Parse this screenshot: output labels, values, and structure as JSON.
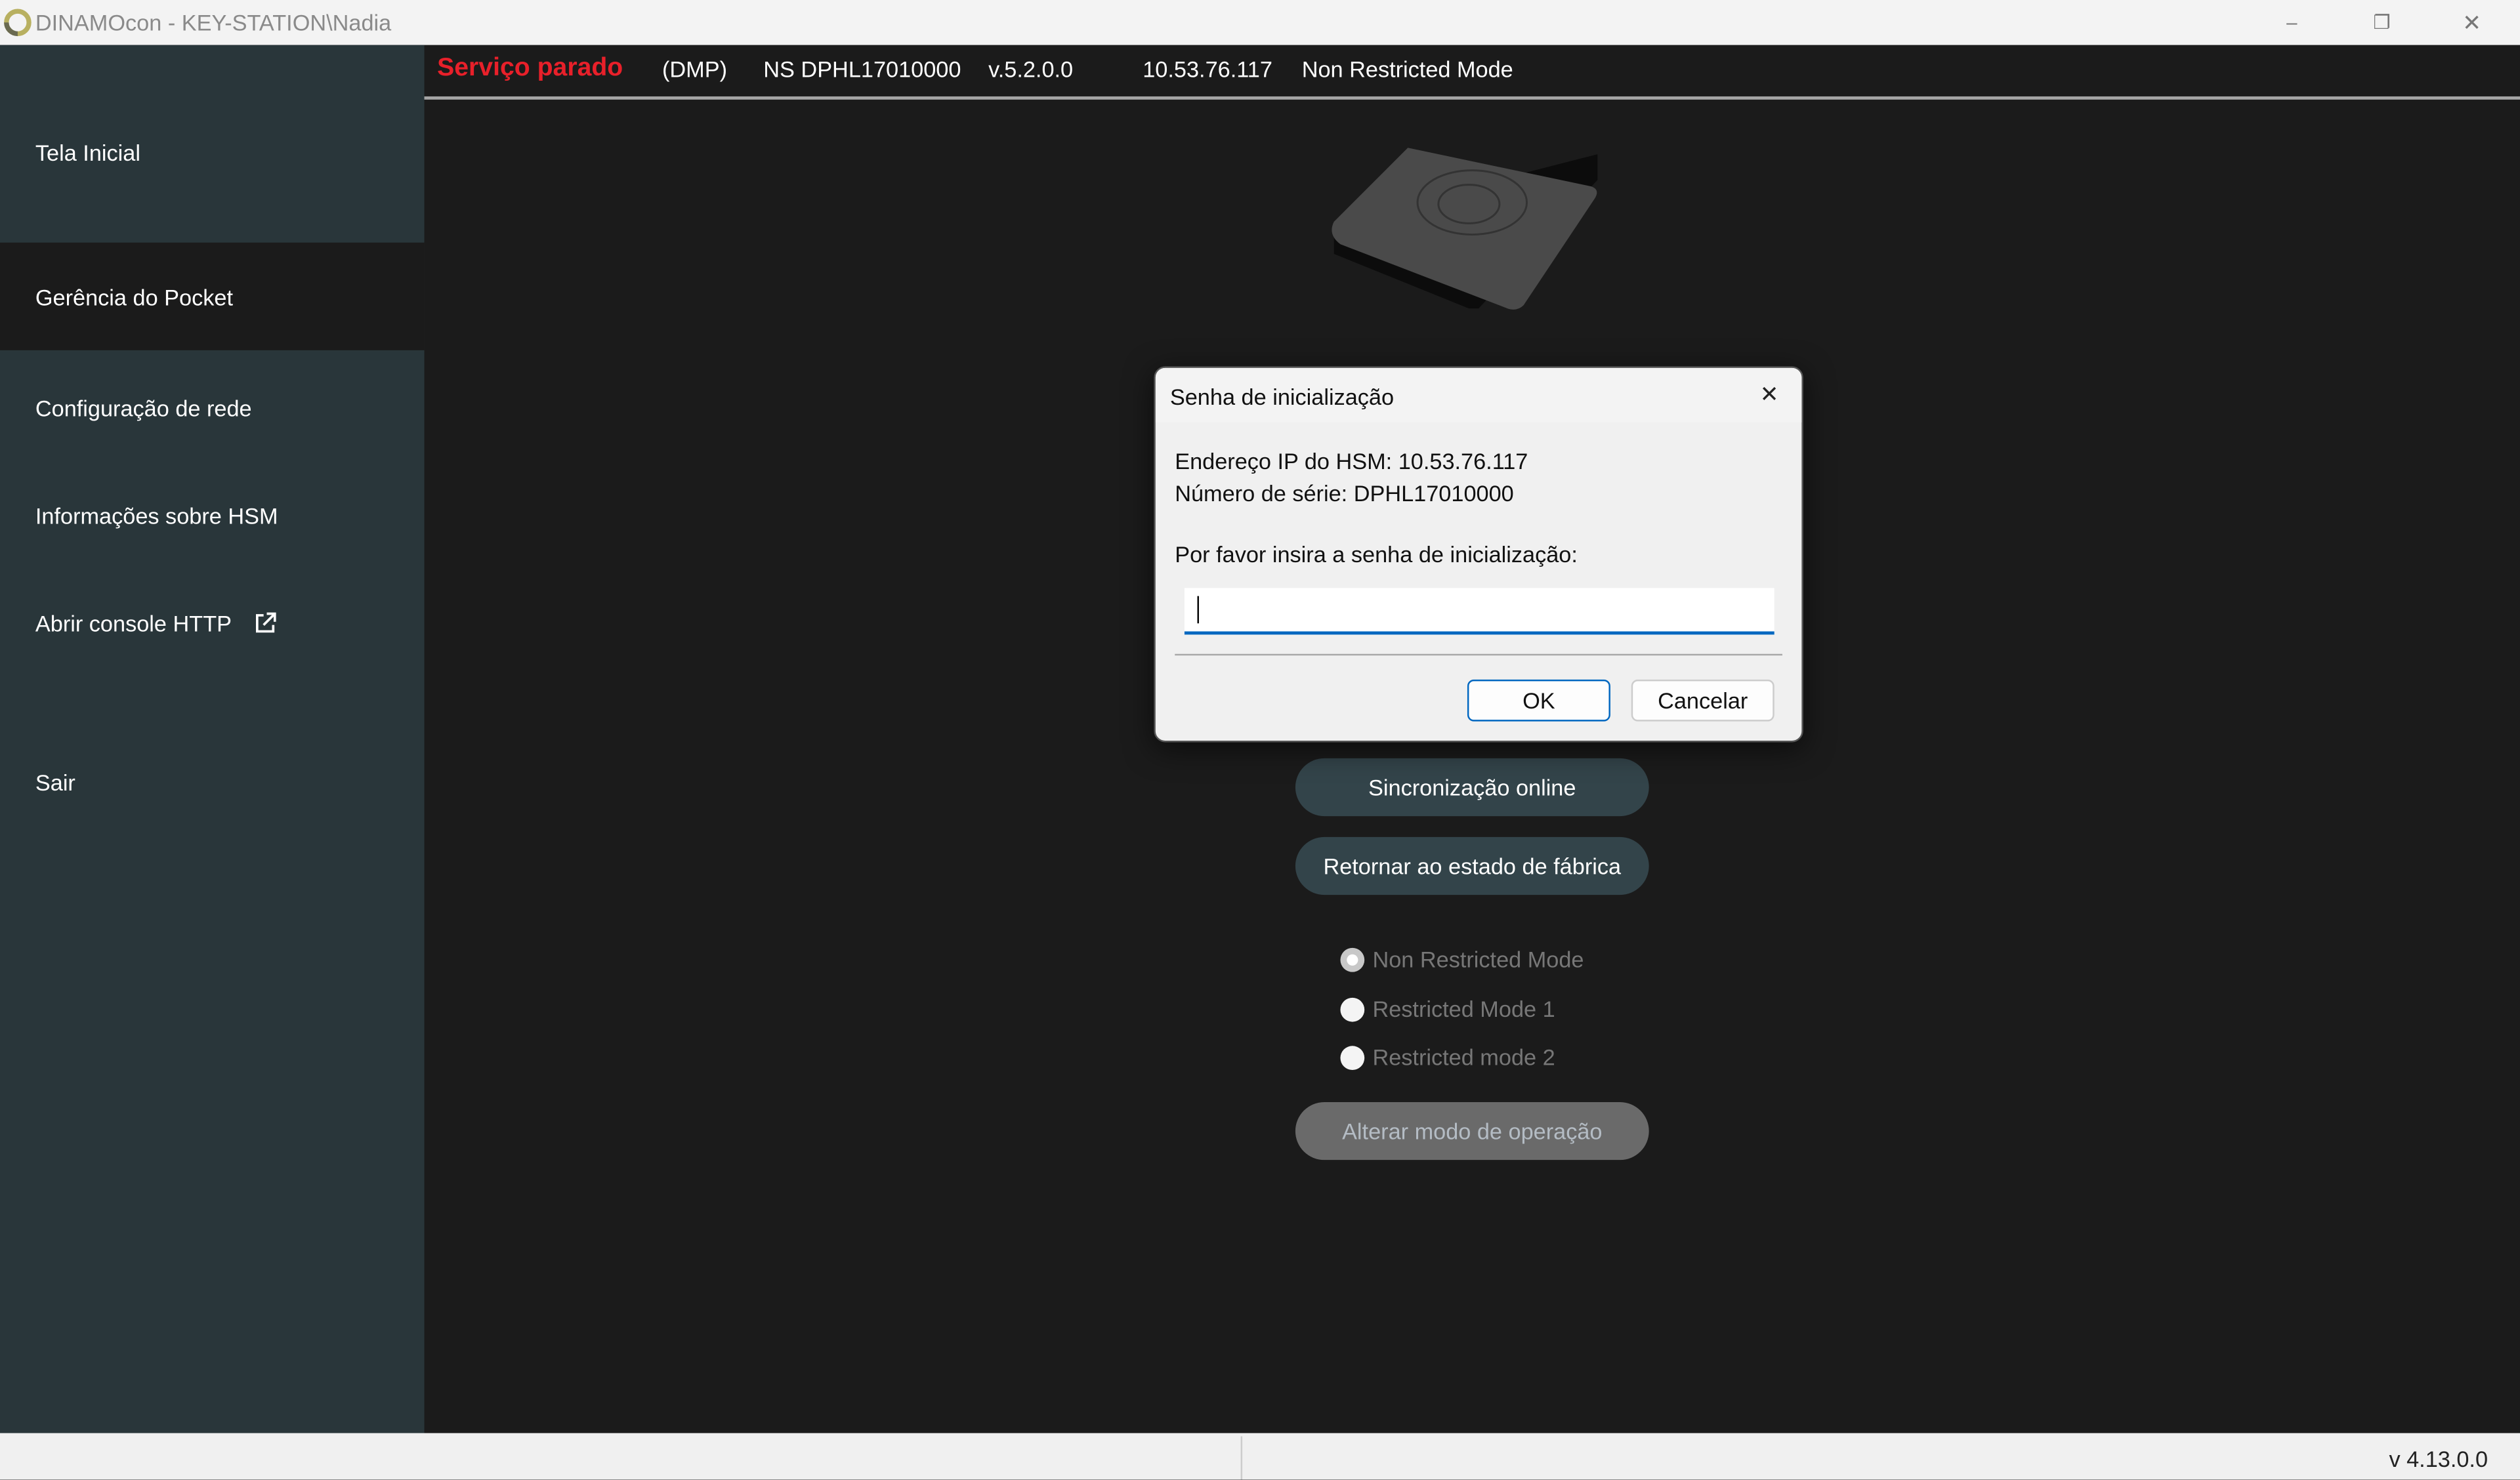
{
  "window": {
    "title": "DINAMOcon - KEY-STATION\\Nadia",
    "controls": [
      "minimize-icon",
      "restore-icon",
      "close-icon"
    ]
  },
  "sidebar": {
    "items": [
      {
        "label": "Tela Inicial"
      },
      {
        "label": "Gerência do Pocket",
        "selected": true
      },
      {
        "label": "Configuração de rede"
      },
      {
        "label": "Informações sobre HSM"
      },
      {
        "label": "Abrir console HTTP",
        "icon": "external-link-icon"
      },
      {
        "label": "Sair"
      }
    ]
  },
  "header": {
    "status": "Serviço parado",
    "status_color": "#e8202a",
    "type": "(DMP)",
    "serial": "NS DPHL17010000",
    "version": "v.5.2.0.0",
    "ip": "10.53.76.117",
    "mode": "Non Restricted Mode"
  },
  "main": {
    "buttons": {
      "sync": "Sincronização online",
      "factory_reset": "Retornar ao estado de fábrica",
      "change_mode": "Alterar modo de operação"
    },
    "modes": [
      {
        "label": "Non Restricted Mode",
        "selected": true
      },
      {
        "label": "Restricted Mode 1",
        "selected": false
      },
      {
        "label": "Restricted mode 2",
        "selected": false
      }
    ]
  },
  "dialog": {
    "title": "Senha de inicialização",
    "ip_line": "Endereço IP do HSM: 10.53.76.117",
    "serial_line": "Número de série: DPHL17010000",
    "prompt": "Por favor insira a senha de inicialização:",
    "password_value": "",
    "ok": "OK",
    "cancel": "Cancelar",
    "accent": "#0067c0"
  },
  "statusbar": {
    "version": "v 4.13.0.0"
  }
}
